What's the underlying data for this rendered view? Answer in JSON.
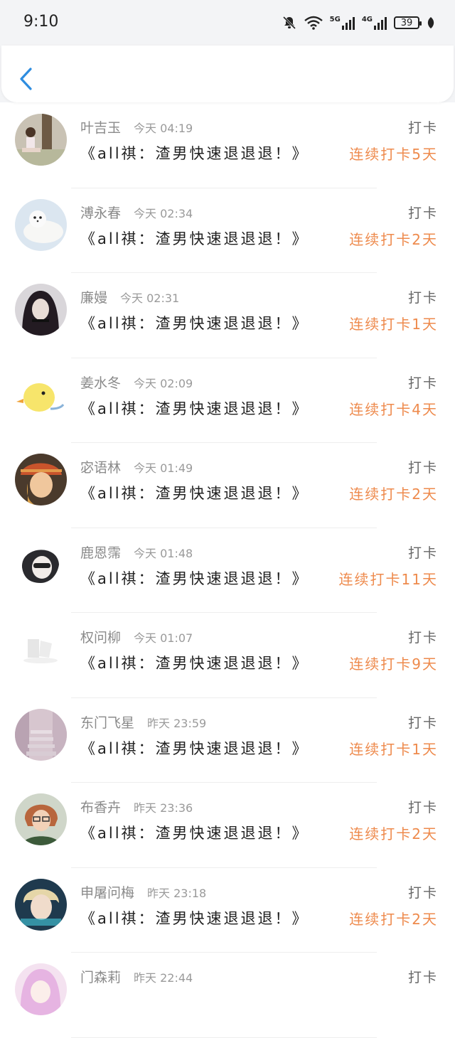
{
  "status_bar": {
    "time": "9:10",
    "network1": "5G",
    "network2": "4G",
    "battery": "39",
    "icons": [
      "bell-off-icon",
      "wifi-icon",
      "signal-icon",
      "battery-icon",
      "leaf-icon"
    ]
  },
  "header": {
    "back_icon": "chevron-left-icon",
    "accent": "#2e8de0"
  },
  "colors": {
    "streak": "#ee8a4c",
    "name": "#8a8a8a"
  },
  "items": [
    {
      "name": "叶吉玉",
      "time": "今天 04:19",
      "title": "《all祺：渣男快速退退退！》",
      "tag": "打卡",
      "streak": "连续打卡5天",
      "avatar": "avatar-girl-tree"
    },
    {
      "name": "溥永春",
      "time": "今天 02:34",
      "title": "《all祺：渣男快速退退退！》",
      "tag": "打卡",
      "streak": "连续打卡2天",
      "avatar": "avatar-seal"
    },
    {
      "name": "廉嫚",
      "time": "今天 02:31",
      "title": "《all祺：渣男快速退退退！》",
      "tag": "打卡",
      "streak": "连续打卡1天",
      "avatar": "avatar-dark-hair-girl"
    },
    {
      "name": "姜水冬",
      "time": "今天 02:09",
      "title": "《all祺：渣男快速退退退！》",
      "tag": "打卡",
      "streak": "连续打卡4天",
      "avatar": "avatar-yellow-chick"
    },
    {
      "name": "宓语林",
      "time": "今天 01:49",
      "title": "《all祺：渣男快速退退退！》",
      "tag": "打卡",
      "streak": "连续打卡2天",
      "avatar": "avatar-orange-scarf"
    },
    {
      "name": "鹿恩霈",
      "time": "今天 01:48",
      "title": "《all祺：渣男快速退退退！》",
      "tag": "打卡",
      "streak": "连续打卡11天",
      "avatar": "avatar-mask"
    },
    {
      "name": "权问柳",
      "time": "今天 01:07",
      "title": "《all祺：渣男快速退退退！》",
      "tag": "打卡",
      "streak": "连续打卡9天",
      "avatar": "avatar-faint-shapes"
    },
    {
      "name": "东门飞星",
      "time": "昨天 23:59",
      "title": "《all祺：渣男快速退退退！》",
      "tag": "打卡",
      "streak": "连续打卡1天",
      "avatar": "avatar-stairs"
    },
    {
      "name": "布香卉",
      "time": "昨天 23:36",
      "title": "《all祺：渣男快速退退退！》",
      "tag": "打卡",
      "streak": "连续打卡2天",
      "avatar": "avatar-woman-glasses"
    },
    {
      "name": "申屠问梅",
      "time": "昨天 23:18",
      "title": "《all祺：渣男快速退退退！》",
      "tag": "打卡",
      "streak": "连续打卡2天",
      "avatar": "avatar-blond-boy"
    },
    {
      "name": "门森莉",
      "time": "昨天 22:44",
      "title": "",
      "tag": "打卡",
      "streak": "",
      "avatar": "avatar-pink-hair"
    }
  ]
}
